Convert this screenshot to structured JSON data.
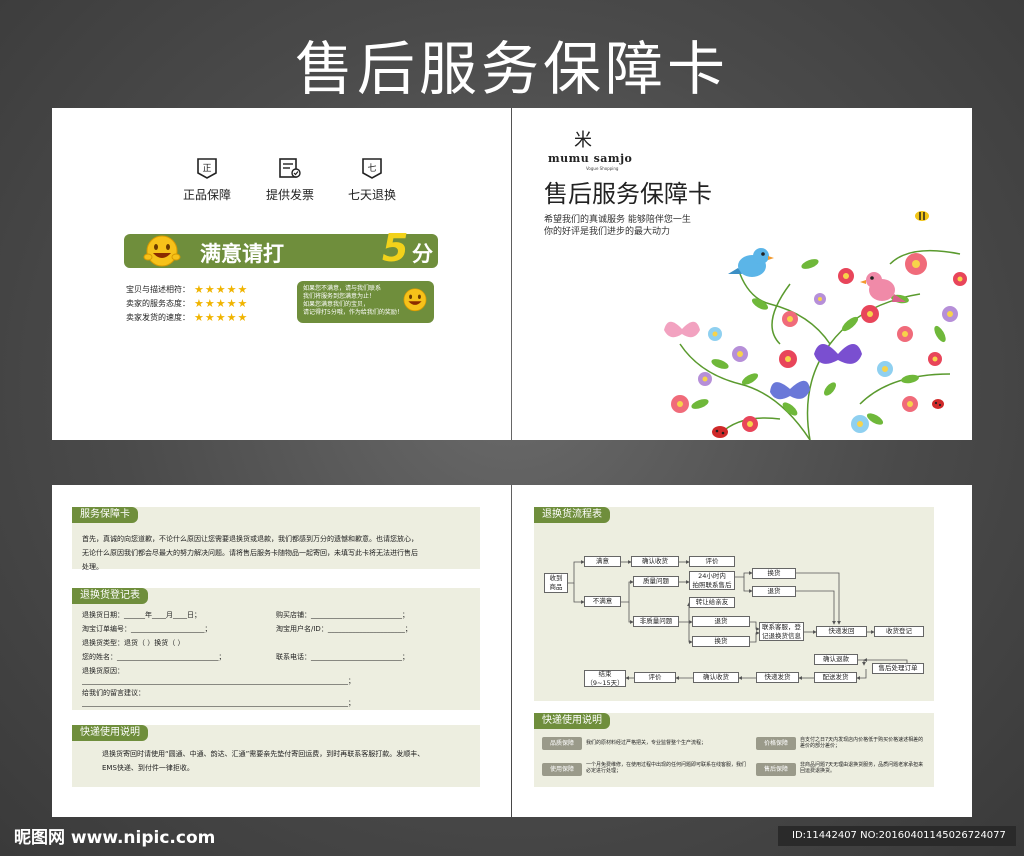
{
  "title": "售后服务保障卡",
  "top_left": {
    "features": [
      {
        "icon": "seal-icon",
        "label": "正品保障",
        "glyph": "正"
      },
      {
        "icon": "invoice-icon",
        "label": "提供发票",
        "glyph": ""
      },
      {
        "icon": "return-7day-icon",
        "label": "七天退换",
        "glyph": "七"
      }
    ],
    "banner_text": "满意请打",
    "banner_num": "5",
    "banner_suffix": "分哦！",
    "ratings": [
      {
        "label": "宝贝与描述相符：",
        "stars": "★★★★★"
      },
      {
        "label": "卖家的服务态度：",
        "stars": "★★★★★"
      },
      {
        "label": "卖家发货的速度：",
        "stars": "★★★★★"
      }
    ],
    "note_lines": [
      "如果您不满意，请与我们联系",
      "我们将服务到您满意为止！",
      "如果您满意我们的宝贝，",
      "请记得打5分哦，作为给我们的奖励！"
    ]
  },
  "top_right": {
    "brand_mark": "米",
    "brand_name": "mumu samjo",
    "brand_sub": "Vogue Shopping",
    "title": "售后服务保障卡",
    "line1": "希望我们的真诚服务  能够陪伴您一生",
    "line2": "你的好评是我们进步的最大动力"
  },
  "bottom_left": {
    "sec1_tab": "服务保障卡",
    "sec1_text1": "首先，真诚的向您道歉，不论什么原因让您需要退换货或退款，我们都感到万分的遗憾和歉意。也请您放心，",
    "sec1_text2": "无论什么原因我们都会尽最大的努力解决问题。请将售后服务卡随物品一起寄回，未填写此卡将无法进行售后",
    "sec1_text3": "处理。",
    "sec2_tab": "退换货登记表",
    "form": {
      "date": "退换货日期：______年____月____日；",
      "shop": "购买店铺：__________________________；",
      "order": "淘宝订单编号：_____________________；",
      "user": "淘宝用户名/ID：______________________；",
      "type": "退换货类型：退货（  ）换货（  ）",
      "name": "您的姓名：_____________________________；",
      "phone": "联系电话：__________________________；",
      "reason": "退换货原因：",
      "reason_line": "____________________________________________________________________________；",
      "suggest": "给我们的留言建议：",
      "suggest_line": "____________________________________________________________________________；"
    },
    "sec3_tab": "快递使用说明",
    "sec3_text1": "退换货寄回时请使用“圆通、中通、韵达、汇通”需要亲先垫付寄回运费，到时再联系客服打款。发顺丰、",
    "sec3_text2": "EMS快递、到付件一律拒收。"
  },
  "bottom_right": {
    "flow_tab": "退换货流程表",
    "nodes": {
      "receive": "收到\n商品",
      "satisfied": "满意",
      "confirm1": "确认收货",
      "review1": "评价",
      "unsatisfied": "不满意",
      "quality": "质量问题",
      "hours24": "24小时内\n拍照联系售后",
      "exchange1": "换货",
      "refund1": "退货",
      "transfer": "转让给亲友",
      "nonquality": "非质量问题",
      "refund2": "退货",
      "exchange2": "换货",
      "contact": "联系客服，登\n记退换货信息",
      "ship": "快递发回",
      "register": "收货登记",
      "confirm_return": "确认退款",
      "process": "售后处理订单",
      "end": "结束\n（9~15天）",
      "review2": "评价",
      "confirm2": "确认收货",
      "express": "快递发货",
      "dispatch": "配送发货"
    },
    "qs_tab": "快递使用说明",
    "qs": [
      {
        "tag": "品质保障",
        "text": "我们的原材料经过严格把关，专业监督整个生产流程；"
      },
      {
        "tag": "价格保障",
        "text": "自支付之日7天内发现店内价格低于购买价格速述相差的差价的部分差价；"
      },
      {
        "tag": "使用保障",
        "text": "一个月免费维修，在使用过程中出现的任何问题即可联系在线客服，我们必定进行处理；"
      },
      {
        "tag": "售后保障",
        "text": "非商品问题7天无理由退换货服务，品质问题老家承担来回运费退换货。"
      }
    ]
  },
  "footer": {
    "site": "昵图网 www.nipic.com",
    "id": "ID:11442407 NO:20160401145026724077"
  }
}
